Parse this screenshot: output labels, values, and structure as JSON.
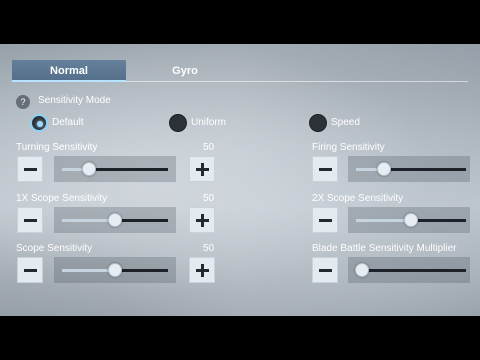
{
  "tabs": {
    "normal": "Normal",
    "gyro": "Gyro"
  },
  "sensitivity_mode": {
    "help_icon": "?",
    "label": "Sensitivity Mode",
    "options": [
      "Default",
      "Uniform",
      "Speed"
    ],
    "selected": "Default"
  },
  "settings": {
    "turning": {
      "label": "Turning Sensitivity",
      "value": "50",
      "level": 0.25
    },
    "scope_1x": {
      "label": "1X Scope Sensitivity",
      "value": "50",
      "level": 0.5
    },
    "scope": {
      "label": "Scope Sensitivity",
      "value": "50",
      "level": 0.5
    },
    "firing": {
      "label": "Firing Sensitivity",
      "level": 0.25
    },
    "scope_2x": {
      "label": "2X Scope Sensitivity",
      "level": 0.5
    },
    "blade_battle": {
      "label": "Blade Battle Sensitivity Multiplier",
      "level": 0.05
    }
  },
  "icons": {
    "minus": "minus-icon",
    "plus": "plus-icon"
  },
  "colors": {
    "accent": "#9fdcff",
    "track": "#1c2227",
    "button": "#e4ebf0"
  }
}
